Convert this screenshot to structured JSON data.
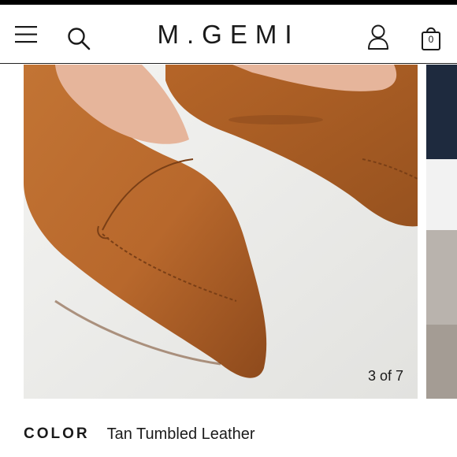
{
  "header": {
    "logo": "M.GEMI",
    "menu_icon": "hamburger-menu-icon",
    "search_icon": "search-icon",
    "account_icon": "account-icon",
    "bag_icon": "shopping-bag-icon",
    "bag_count": "0"
  },
  "gallery": {
    "counter": "3 of 7",
    "main_image": "tan leather pointed loafers",
    "colors": {
      "leather": "#b8682c",
      "leather_dark": "#8e4a1c",
      "lining": "#e6b59b",
      "background": "#ededeb"
    }
  },
  "product": {
    "color_label": "COLOR",
    "color_value": "Tan Tumbled Leather"
  }
}
